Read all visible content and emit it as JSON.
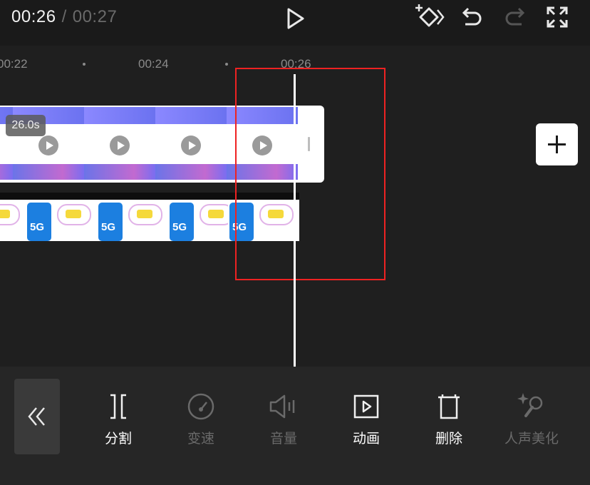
{
  "header": {
    "current_time": "00:26",
    "separator": "/",
    "total_time": "00:27",
    "icons": [
      "play-icon",
      "add-keyframe-icon",
      "undo-icon",
      "redo-icon",
      "fullscreen-icon"
    ]
  },
  "ruler": {
    "ticks": [
      "00:22",
      "00:24",
      "00:26"
    ]
  },
  "main_track": {
    "duration_badge": "26.0s",
    "frame_count": 4
  },
  "add_button": {
    "icon": "plus-icon"
  },
  "toolbar": {
    "collapse_icon": "double-chevron-left-icon",
    "tools": [
      {
        "label": "分割",
        "enabled": true,
        "icon": "split-icon"
      },
      {
        "label": "变速",
        "enabled": false,
        "icon": "speed-icon"
      },
      {
        "label": "音量",
        "enabled": false,
        "icon": "volume-icon"
      },
      {
        "label": "动画",
        "enabled": true,
        "icon": "animation-icon"
      },
      {
        "label": "删除",
        "enabled": true,
        "icon": "delete-icon"
      },
      {
        "label": "人声美化",
        "enabled": false,
        "icon": "voice-beautify-icon"
      }
    ]
  },
  "colors": {
    "background": "#1f1f1f",
    "selection_box": "#ee2222",
    "disabled_text": "#6a6a6a"
  }
}
